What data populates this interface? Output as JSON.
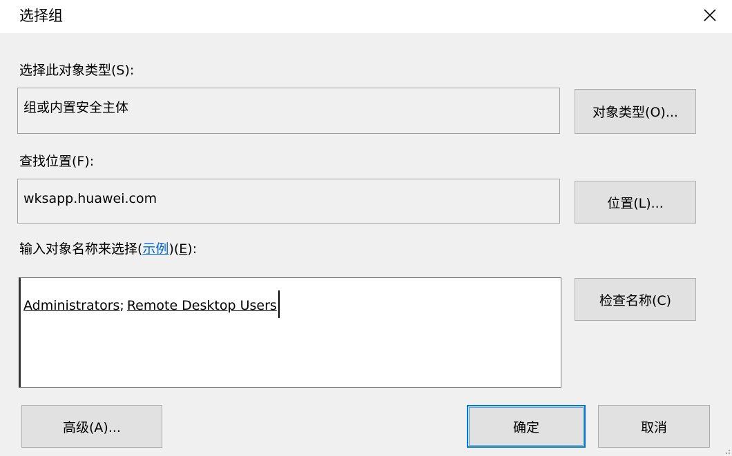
{
  "window": {
    "title": "选择组",
    "close_icon": "close-icon"
  },
  "object_type": {
    "label": "选择此对象类型(S):",
    "value": "组或内置安全主体",
    "button": "对象类型(O)..."
  },
  "location": {
    "label": "查找位置(F):",
    "value": "wksapp.huawei.com",
    "button": "位置(L)..."
  },
  "names": {
    "label_prefix": "输入对象名称来选择(",
    "label_link": "示例",
    "label_suffix_open": ")(",
    "label_accel": "E",
    "label_suffix_close": "):",
    "entries": [
      "Administrators",
      "Remote Desktop Users"
    ],
    "separator": ";",
    "check_button": "检查名称(C)"
  },
  "footer": {
    "advanced_button": "高级(A)...",
    "ok_button": "确定",
    "cancel_button": "取消"
  },
  "colors": {
    "dialog_bg": "#f0f0f0",
    "title_bg": "#ffffff",
    "button_bg": "#e1e1e1",
    "default_button_border": "#0078d7",
    "link": "#0066cc"
  }
}
